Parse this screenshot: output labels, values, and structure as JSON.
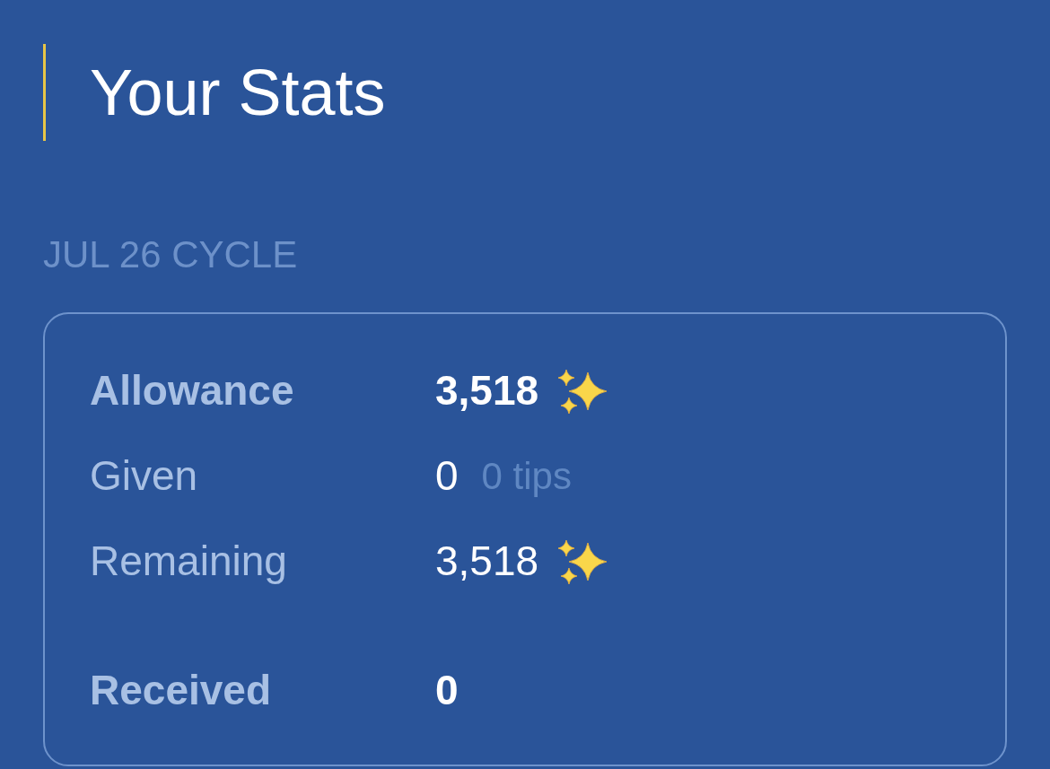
{
  "title": "Your Stats",
  "cycle_label": "JUL 26 CYCLE",
  "stats": {
    "groups": [
      {
        "rows": [
          {
            "kind": "total",
            "label": "Allowance",
            "value": "3,518",
            "sparkles": true
          },
          {
            "kind": "detail",
            "label": "Given",
            "value": "0",
            "note": "0 tips",
            "sparkles": false
          },
          {
            "kind": "detail",
            "label": "Remaining",
            "value": "3,518",
            "sparkles": true
          }
        ]
      },
      {
        "rows": [
          {
            "kind": "total",
            "label": "Received",
            "value": "0",
            "sparkles": false
          }
        ]
      }
    ]
  }
}
